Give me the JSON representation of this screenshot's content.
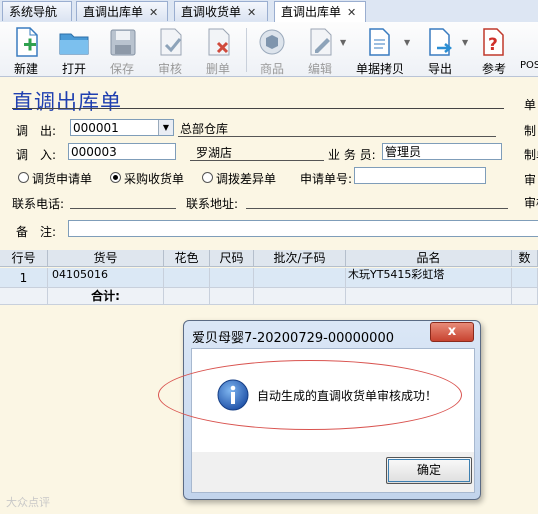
{
  "tabs": [
    {
      "label": "系统导航",
      "closable": false
    },
    {
      "label": "直调出库单",
      "closable": true
    },
    {
      "label": "直调收货单",
      "closable": true
    },
    {
      "label": "直调出库单",
      "closable": true
    }
  ],
  "toolbar": {
    "new": "新建",
    "open": "打开",
    "save": "保存",
    "audit": "审核",
    "delete": "删单",
    "product": "商品",
    "edit": "编辑",
    "copy": "单据拷贝",
    "export": "导出",
    "help": "参考",
    "pos": "POS"
  },
  "form": {
    "title": "直调出库单",
    "out_label": "调　出:",
    "out_code": "000001",
    "out_name": "总部仓库",
    "in_label": "调　入:",
    "in_code": "000003",
    "in_name": "罗湖店",
    "staff_label": "业 务 员:",
    "staff_value": "管理员",
    "radio_apply": "调货申请单",
    "radio_purchase": "采购收货单",
    "radio_diff": "调拨差异单",
    "apply_no_label": "申请单号:",
    "apply_no_value": "",
    "phone_label": "联系电话:",
    "address_label": "联系地址:",
    "remark_label": "备　注:",
    "right_labels": [
      "单",
      "制",
      "制单",
      "审",
      "审核"
    ]
  },
  "grid": {
    "headers": [
      "行号",
      "货号",
      "花色",
      "尺码",
      "批次/子码",
      "品名",
      "数"
    ],
    "rows": [
      {
        "line": "1",
        "sku": "04105016",
        "color": "",
        "size": "",
        "batch": "",
        "name": "木玩YT5415彩虹塔"
      }
    ],
    "summary_label": "合计:"
  },
  "dialog": {
    "title": "爱贝母婴7-20200729-00000000",
    "message": "自动生成的直调收货单审核成功！",
    "ok": "确定",
    "close_symbol": "x"
  },
  "watermark": "大众点评"
}
